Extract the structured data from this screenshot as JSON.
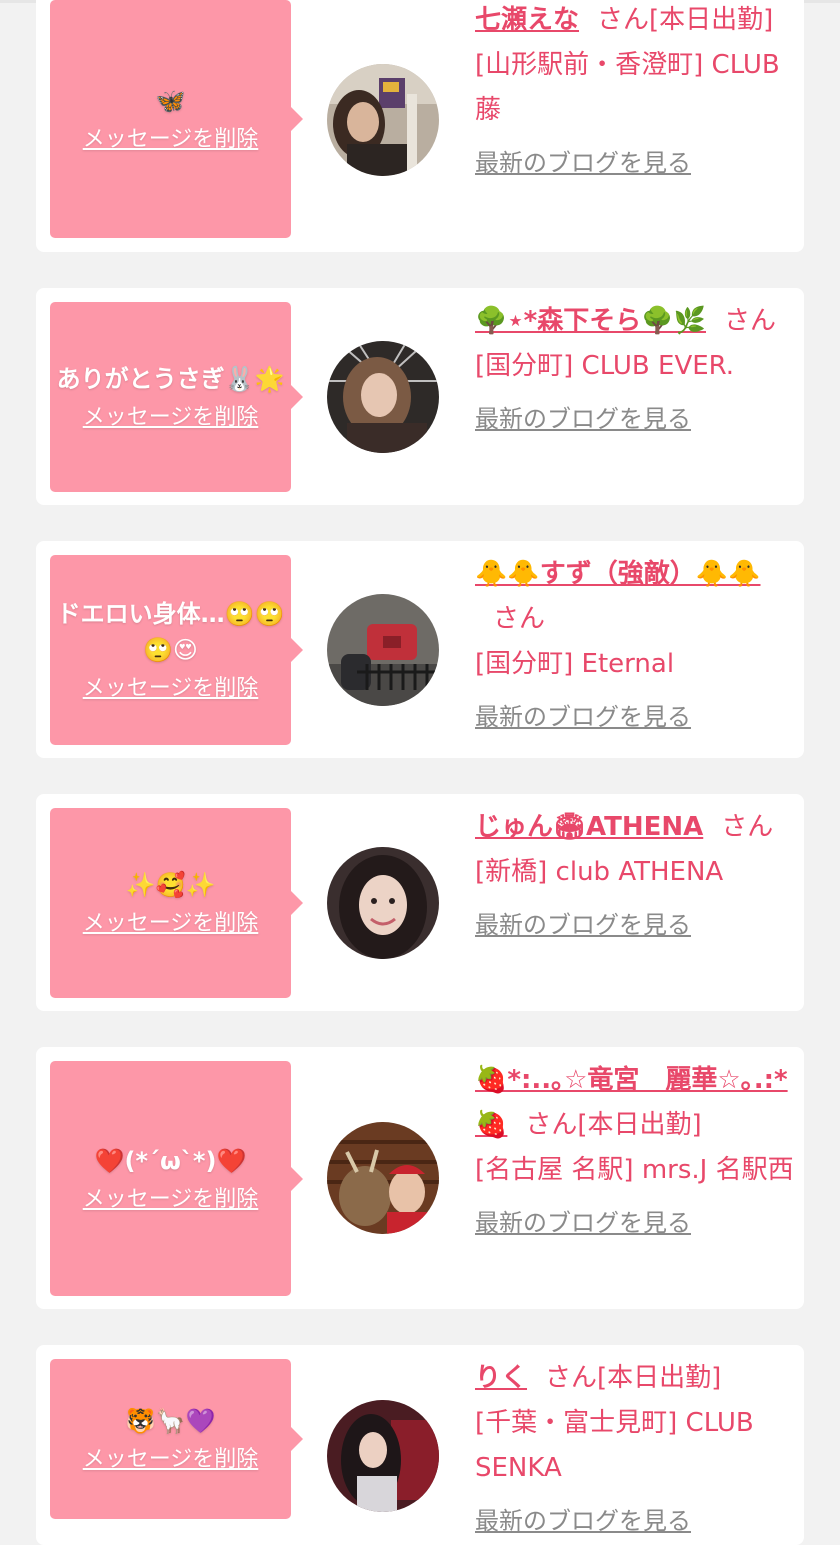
{
  "delete_label": "メッセージを削除",
  "blog_label": "最新のブログを見る",
  "san_suffix": "さん",
  "cards": [
    {
      "message": "🦋",
      "name": "七瀬えな",
      "status": "[本日出勤]",
      "shop": "[山形駅前・香澄町] CLUB 藤"
    },
    {
      "message": "ありがとうさぎ🐰🌟",
      "name": "🌳⋆*森下そら🌳🌿",
      "status": "",
      "shop": "[国分町] CLUB EVER."
    },
    {
      "message": "ドエロい身体…🙄🙄🙄😍",
      "name": "🐥🐥すず（強敵）🐥🐥",
      "status": "",
      "shop": "[国分町] Eternal"
    },
    {
      "message": "✨🥰✨",
      "name": "じゅん🏟ATHENA",
      "status": "",
      "shop": "[新橋] club ATHENA"
    },
    {
      "message": "❤️(*´ω`*)❤️",
      "name": "🍓*:..｡☆竜宮　麗華☆｡.:*🍓",
      "status": "[本日出勤]",
      "shop": "[名古屋 名駅] mrs.J 名駅西"
    },
    {
      "message": "🐯🦙💜",
      "name": "りく",
      "status": "[本日出勤]",
      "shop": "[千葉・富士見町] CLUB SENKA"
    }
  ]
}
